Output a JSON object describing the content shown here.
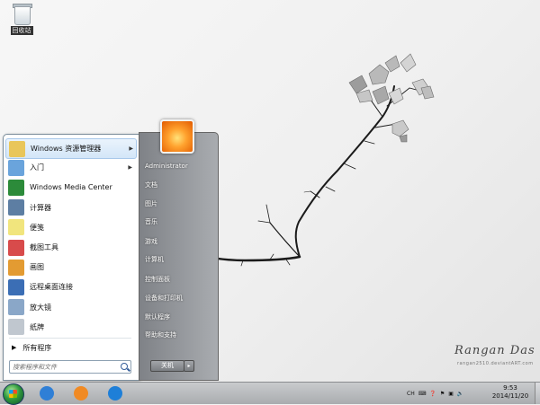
{
  "desktop": {
    "icons": [
      {
        "label": "回收站",
        "icon": "recycle-bin-icon"
      }
    ],
    "signature": "Rangan Das",
    "signature_sub": "rangan2510.deviantART.com"
  },
  "start_menu": {
    "programs": [
      {
        "label": "Windows 资源管理器",
        "icon": "explorer-icon",
        "color": "#e9c65a",
        "has_submenu": true,
        "highlighted": true
      },
      {
        "label": "入门",
        "icon": "getting-started-icon",
        "color": "#6aa4dc",
        "has_submenu": true
      },
      {
        "label": "Windows Media Center",
        "icon": "media-center-icon",
        "color": "#2c8b3a",
        "has_submenu": false
      },
      {
        "label": "计算器",
        "icon": "calculator-icon",
        "color": "#5d7ea3",
        "has_submenu": false
      },
      {
        "label": "便笺",
        "icon": "sticky-notes-icon",
        "color": "#f1e57d",
        "has_submenu": false
      },
      {
        "label": "截图工具",
        "icon": "snipping-tool-icon",
        "color": "#d84b4b",
        "has_submenu": false
      },
      {
        "label": "画图",
        "icon": "paint-icon",
        "color": "#e39b32",
        "has_submenu": false
      },
      {
        "label": "远程桌面连接",
        "icon": "remote-desktop-icon",
        "color": "#3b6eb5",
        "has_submenu": false
      },
      {
        "label": "放大镜",
        "icon": "magnifier-icon",
        "color": "#8aa7c8",
        "has_submenu": false
      },
      {
        "label": "纸牌",
        "icon": "solitaire-icon",
        "color": "#c0c7cf",
        "has_submenu": false
      }
    ],
    "all_programs": "所有程序",
    "search_placeholder": "搜索程序和文件",
    "user_name": "Administrator",
    "right_items": [
      "文档",
      "图片",
      "音乐",
      "游戏",
      "计算机",
      "控制面板",
      "设备和打印机",
      "默认程序",
      "帮助和支持"
    ],
    "shutdown_label": "关机"
  },
  "taskbar": {
    "pinned": [
      {
        "icon": "internet-explorer-icon",
        "color": "#2f7fd6"
      },
      {
        "icon": "media-player-icon",
        "color": "#f08a24"
      },
      {
        "icon": "kugou-icon",
        "color": "#1e7fd8"
      }
    ],
    "tray": {
      "language": "CH"
    },
    "time": "9:53",
    "date": "2014/11/20"
  }
}
